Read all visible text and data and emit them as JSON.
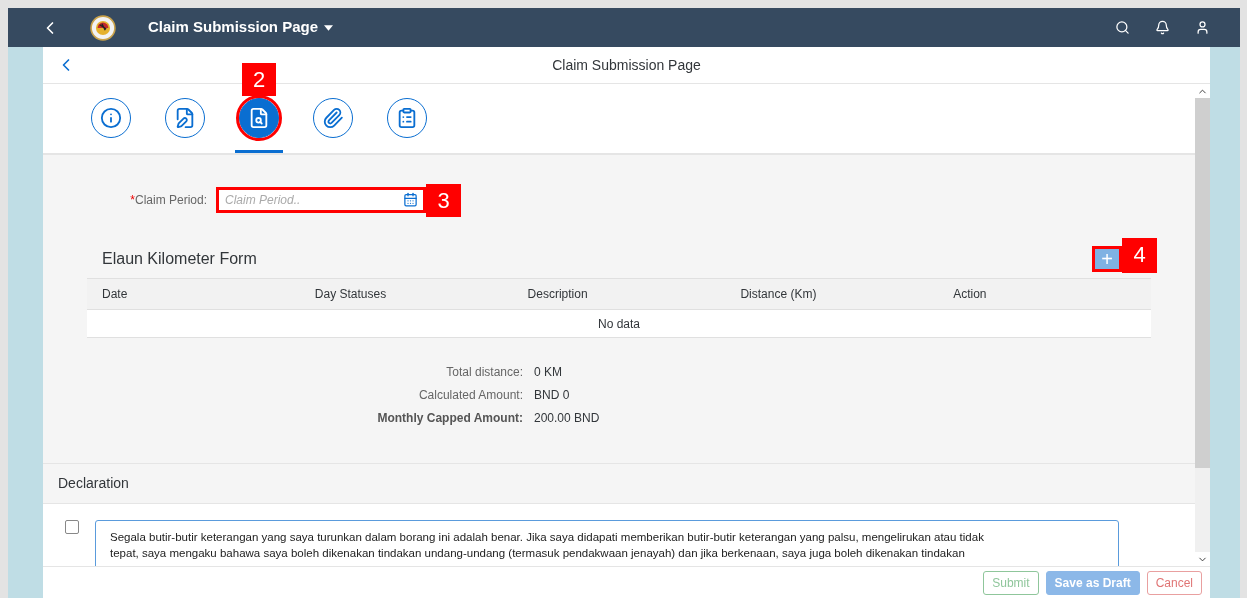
{
  "shell_bar": {
    "title": "Claim Submission Page"
  },
  "page": {
    "title": "Claim Submission Page"
  },
  "tabs": [
    {
      "kind": "info",
      "selected": false
    },
    {
      "kind": "edit",
      "selected": false
    },
    {
      "kind": "review",
      "selected": true,
      "callout": "2"
    },
    {
      "kind": "attachment",
      "selected": false
    },
    {
      "kind": "clipboard",
      "selected": false
    }
  ],
  "claim_period": {
    "label": "Claim Period:",
    "required_mark": "*",
    "placeholder": "Claim Period..",
    "callout": "3"
  },
  "form": {
    "title": "Elaun Kilometer Form",
    "add_button": {
      "label": "+",
      "callout": "4"
    }
  },
  "table": {
    "columns": [
      "Date",
      "Day Statuses",
      "Description",
      "Distance (Km)",
      "Action"
    ],
    "empty_text": "No data"
  },
  "totals": [
    {
      "label": "Total distance:",
      "value": "0 KM",
      "emphasized": false
    },
    {
      "label": "Calculated Amount:",
      "value": "BND 0",
      "emphasized": false
    },
    {
      "label": "Monthly Capped Amount:",
      "value": "200.00 BND",
      "emphasized": true
    }
  ],
  "declaration": {
    "title": "Declaration",
    "checked": false,
    "lines": [
      "Segala butir-butir keterangan yang saya turunkan dalam borang ini adalah benar. Jika saya didapati memberikan butir-butir keterangan yang palsu, mengelirukan atau tidak",
      "tepat, saya mengaku bahawa saya boleh dikenakan tindakan undang-undang (termasuk pendakwaan jenayah) dan jika berkenaan, saya juga boleh dikenakan tindakan"
    ]
  },
  "footer_buttons": [
    {
      "label": "Submit",
      "kind": "accept"
    },
    {
      "label": "Save as Draft",
      "kind": "emphasized"
    },
    {
      "label": "Cancel",
      "kind": "reject"
    }
  ]
}
